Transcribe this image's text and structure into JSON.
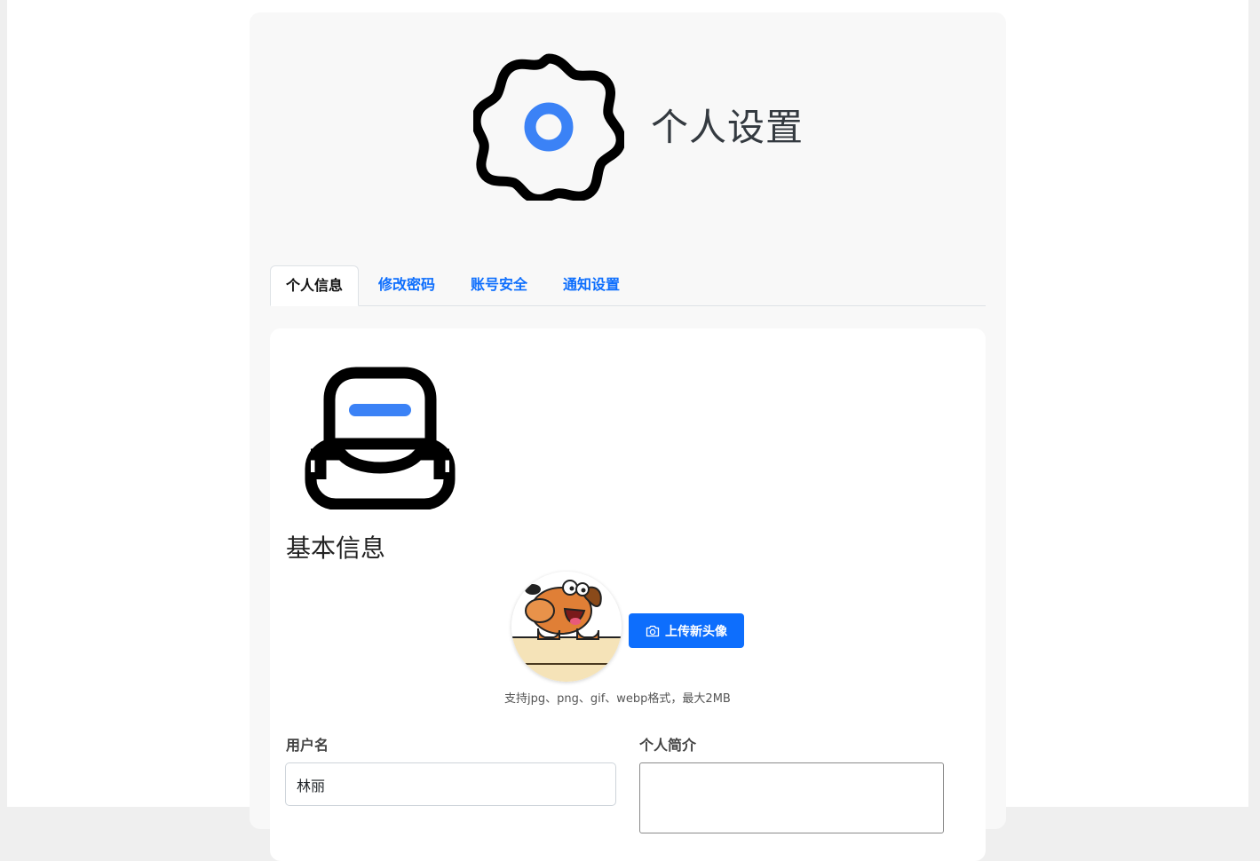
{
  "header": {
    "title": "个人设置",
    "icon": "settings-gear-icon",
    "accent_color": "#3b82f6"
  },
  "tabs": [
    {
      "label": "个人信息",
      "active": true
    },
    {
      "label": "修改密码",
      "active": false
    },
    {
      "label": "账号安全",
      "active": false
    },
    {
      "label": "通知设置",
      "active": false
    }
  ],
  "basic_info": {
    "icon": "inbox-icon",
    "title": "基本信息",
    "avatar": {
      "image": "cartoon-dog-avatar",
      "upload_label": "上传新头像",
      "upload_icon": "camera-icon",
      "hint": "支持jpg、png、gif、webp格式，最大2MB"
    },
    "username": {
      "label": "用户名",
      "value": "林丽"
    },
    "bio": {
      "label": "个人简介",
      "value": ""
    }
  },
  "colors": {
    "primary": "#0d6efd",
    "icon_accent": "#3b82f6"
  }
}
